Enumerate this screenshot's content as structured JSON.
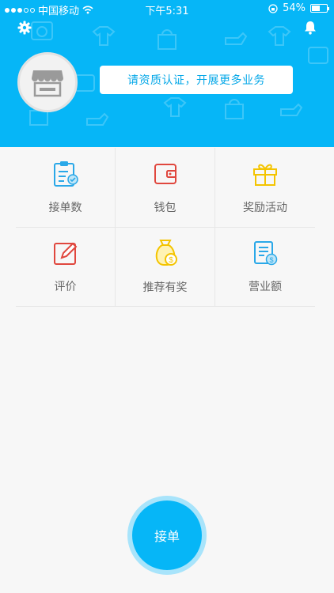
{
  "status_bar": {
    "carrier": "中国移动",
    "time": "下午5:31",
    "battery": "54%",
    "battery_level": 0.54
  },
  "header": {
    "banner_text": "请资质认证，开展更多业务",
    "settings_icon": "gear-icon",
    "notification_icon": "bell-icon",
    "avatar_icon": "store-icon",
    "background_color": "#06b6f7"
  },
  "menu": {
    "items": [
      {
        "label": "接单数",
        "icon": "clipboard-check-icon",
        "color": "#2aa8e8"
      },
      {
        "label": "钱包",
        "icon": "wallet-icon",
        "color": "#e0473e"
      },
      {
        "label": "奖励活动",
        "icon": "gift-icon",
        "color": "#f4c400"
      },
      {
        "label": "评价",
        "icon": "edit-icon",
        "color": "#e0473e"
      },
      {
        "label": "推荐有奖",
        "icon": "money-bag-icon",
        "color": "#f4c400"
      },
      {
        "label": "营业额",
        "icon": "revenue-report-icon",
        "color": "#2aa8e8"
      }
    ]
  },
  "accept_button": {
    "label": "接单"
  }
}
